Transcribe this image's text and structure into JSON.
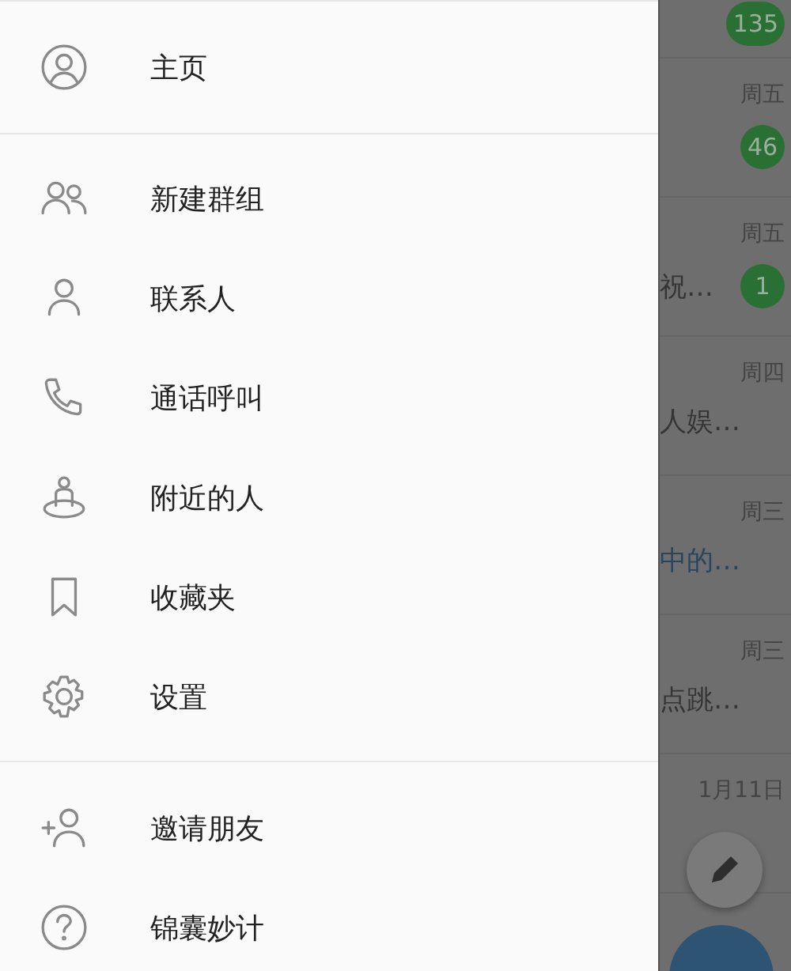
{
  "drawer": {
    "sections": [
      {
        "items": [
          {
            "kind": "profile",
            "label": "主页"
          }
        ]
      },
      {
        "items": [
          {
            "kind": "group",
            "label": "新建群组"
          },
          {
            "kind": "person",
            "label": "联系人"
          },
          {
            "kind": "phone",
            "label": "通话呼叫"
          },
          {
            "kind": "nearby",
            "label": "附近的人"
          },
          {
            "kind": "bookmark",
            "label": "收藏夹"
          },
          {
            "kind": "gear",
            "label": "设置"
          }
        ]
      },
      {
        "items": [
          {
            "kind": "add-person",
            "label": "邀请朋友"
          },
          {
            "kind": "help",
            "label": "锦囊妙计"
          }
        ]
      }
    ]
  },
  "chats": [
    {
      "badge": "135"
    },
    {
      "time": "周五",
      "badge": "46"
    },
    {
      "time": "周五",
      "snippet": "祝…",
      "badge": "1"
    },
    {
      "time": "周四",
      "snippet": "人娱…"
    },
    {
      "time": "周三",
      "snippet": "中的…",
      "highlighted": true
    },
    {
      "time": "周三",
      "snippet": "点跳…"
    },
    {
      "time": "1月11日"
    },
    {
      "avatar": true
    }
  ]
}
